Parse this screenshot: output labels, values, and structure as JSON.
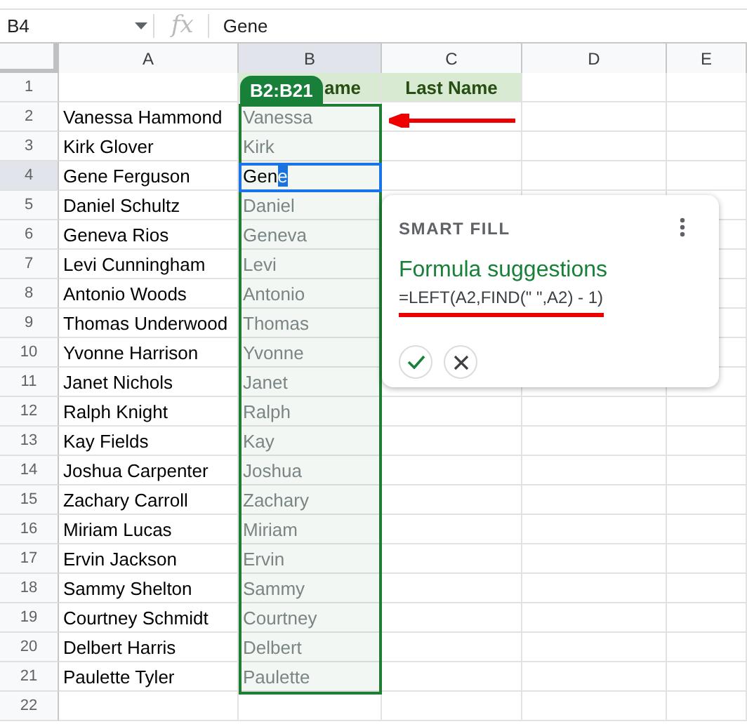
{
  "formula_bar": {
    "name_box": "B4",
    "fx": "fx",
    "value": "Gene"
  },
  "columns": [
    {
      "label": "A",
      "selected": false
    },
    {
      "label": "B",
      "selected": true
    },
    {
      "label": "C",
      "selected": false
    },
    {
      "label": "D",
      "selected": false
    },
    {
      "label": "E",
      "selected": false
    }
  ],
  "header_row": {
    "number": "1",
    "selected": false,
    "b": "ame",
    "c": "Last Name"
  },
  "range_badge": "B2:B21",
  "rows": [
    {
      "number": "2",
      "selected": false,
      "a": "Vanessa Hammond",
      "b": "Vanessa",
      "editing": false
    },
    {
      "number": "3",
      "selected": false,
      "a": "Kirk Glover",
      "b": "Kirk",
      "editing": false
    },
    {
      "number": "4",
      "selected": true,
      "a": "Gene Ferguson",
      "b": "Gen",
      "b_selection": "e",
      "editing": true
    },
    {
      "number": "5",
      "selected": false,
      "a": "Daniel Schultz",
      "b": "Daniel",
      "editing": false
    },
    {
      "number": "6",
      "selected": false,
      "a": "Geneva Rios",
      "b": "Geneva",
      "editing": false
    },
    {
      "number": "7",
      "selected": false,
      "a": "Levi Cunningham",
      "b": "Levi",
      "editing": false
    },
    {
      "number": "8",
      "selected": false,
      "a": "Antonio Woods",
      "b": "Antonio",
      "editing": false
    },
    {
      "number": "9",
      "selected": false,
      "a": "Thomas Underwood",
      "b": "Thomas",
      "editing": false
    },
    {
      "number": "10",
      "selected": false,
      "a": "Yvonne Harrison",
      "b": "Yvonne",
      "editing": false
    },
    {
      "number": "11",
      "selected": false,
      "a": "Janet Nichols",
      "b": "Janet",
      "editing": false
    },
    {
      "number": "12",
      "selected": false,
      "a": "Ralph Knight",
      "b": "Ralph",
      "editing": false
    },
    {
      "number": "13",
      "selected": false,
      "a": "Kay Fields",
      "b": "Kay",
      "editing": false
    },
    {
      "number": "14",
      "selected": false,
      "a": "Joshua Carpenter",
      "b": "Joshua",
      "editing": false
    },
    {
      "number": "15",
      "selected": false,
      "a": "Zachary Carroll",
      "b": "Zachary",
      "editing": false
    },
    {
      "number": "16",
      "selected": false,
      "a": "Miriam Lucas",
      "b": "Miriam",
      "editing": false
    },
    {
      "number": "17",
      "selected": false,
      "a": "Ervin Jackson",
      "b": "Ervin",
      "editing": false
    },
    {
      "number": "18",
      "selected": false,
      "a": "Sammy Shelton",
      "b": "Sammy",
      "editing": false
    },
    {
      "number": "19",
      "selected": false,
      "a": "Courtney Schmidt",
      "b": "Courtney",
      "editing": false
    },
    {
      "number": "20",
      "selected": false,
      "a": "Delbert Harris",
      "b": "Delbert",
      "editing": false
    },
    {
      "number": "21",
      "selected": false,
      "a": "Paulette Tyler",
      "b": "Paulette",
      "editing": false
    },
    {
      "number": "22",
      "selected": false
    }
  ],
  "smart_fill": {
    "title": "SMART FILL",
    "heading": "Formula suggestions",
    "formula": "=LEFT(A2,FIND(\" \",A2) - 1)"
  }
}
